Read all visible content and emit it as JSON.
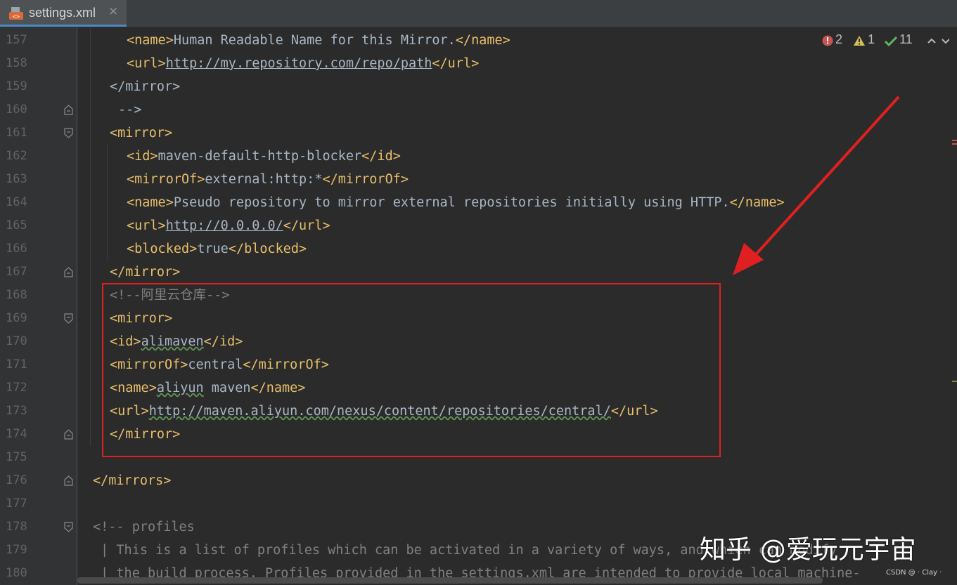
{
  "tab": {
    "filename": "settings.xml",
    "close_glyph": "✕",
    "icon": "xml-file-icon"
  },
  "inspections": {
    "errors": "2",
    "warnings": "1",
    "ok": "11",
    "errors_icon": "error-icon",
    "warnings_icon": "warning-icon",
    "ok_icon": "check-icon",
    "up_icon": "chevron-up-icon",
    "down_icon": "chevron-down-icon"
  },
  "lines": {
    "n157": "157",
    "n158": "158",
    "n159": "159",
    "n160": "160",
    "n161": "161",
    "n162": "162",
    "n163": "163",
    "n164": "164",
    "n165": "165",
    "n166": "166",
    "n167": "167",
    "n168": "168",
    "n169": "169",
    "n170": "170",
    "n171": "171",
    "n172": "172",
    "n173": "173",
    "n174": "174",
    "n175": "175",
    "n176": "176",
    "n177": "177",
    "n178": "178",
    "n179": "179",
    "n180": "180"
  },
  "code": {
    "l157_open": "<name>",
    "l157_text": "Human Readable Name for this Mirror.",
    "l157_close": "</name>",
    "l158_open": "<url>",
    "l158_text": "http://my.repository.com/repo/path",
    "l158_close": "</url>",
    "l159": "</mirror>",
    "l160": "-->",
    "l161": "<mirror>",
    "l162_open": "<id>",
    "l162_text": "maven-default-http-blocker",
    "l162_close": "</id>",
    "l163_open": "<mirrorOf>",
    "l163_text": "external:http:*",
    "l163_close": "</mirrorOf>",
    "l164_open": "<name>",
    "l164_text": "Pseudo repository to mirror external repositories initially using HTTP.",
    "l164_close": "</name>",
    "l165_open": "<url>",
    "l165_text": "http://0.0.0.0/",
    "l165_close": "</url>",
    "l166_open": "<blocked>",
    "l166_text": "true",
    "l166_close": "</blocked>",
    "l167": "</mirror>",
    "l168": "<!--阿里云仓库-->",
    "l169": "<mirror>",
    "l170_open": "<id>",
    "l170_text": "alimaven",
    "l170_close": "</id>",
    "l171_open": "<mirrorOf>",
    "l171_text": "central",
    "l171_close": "</mirrorOf>",
    "l172_open": "<name>",
    "l172_text1": "aliyun",
    "l172_text2": " maven",
    "l172_close": "</name>",
    "l173_open": "<url>",
    "l173_text": "http://maven.aliyun.com/nexus/content/repositories/central/",
    "l173_close": "</url>",
    "l174": "</mirror>",
    "l176": "</mirrors>",
    "l178": "<!-- profiles",
    "l179": " | This is a list of profiles which can be activated in a variety of ways, and which can modify",
    "l180": " | the build process. Profiles provided in the settings.xml are intended to provide local machine-"
  },
  "watermark": {
    "main": "知乎 @爱玩元宇宙",
    "small": "CSDN @ · Clay ·"
  },
  "colors": {
    "tag": "#e8bf6a",
    "text": "#a9b7c6",
    "comment": "#808080",
    "highlight_box": "#e02020",
    "arrow": "#e02020",
    "background": "#2b2b2b"
  }
}
